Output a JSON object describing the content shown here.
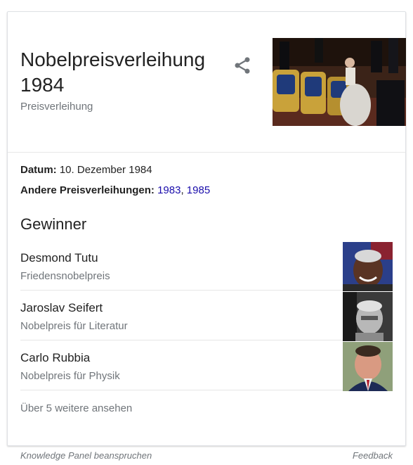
{
  "panel": {
    "title": "Nobelpreisverleihung 1984",
    "subtitle": "Preisverleihung",
    "share_icon": "share-icon",
    "hero_image": "ceremony-photo"
  },
  "facts": {
    "date_label": "Datum:",
    "date_value": "10. Dezember 1984",
    "other_label": "Andere Preisverleihungen:",
    "other_links": [
      "1983",
      "1985"
    ],
    "separator": ", "
  },
  "winners": {
    "heading": "Gewinner",
    "items": [
      {
        "name": "Desmond Tutu",
        "prize": "Friedensnobelpreis"
      },
      {
        "name": "Jaroslav Seifert",
        "prize": "Nobelpreis für Literatur"
      },
      {
        "name": "Carlo Rubbia",
        "prize": "Nobelpreis für Physik"
      }
    ],
    "more": "Über 5 weitere ansehen"
  },
  "footer": {
    "claim": "Knowledge Panel beanspruchen",
    "feedback": "Feedback"
  },
  "colors": {
    "link": "#1a0dab",
    "secondary_text": "#70757a",
    "primary_text": "#222222"
  }
}
